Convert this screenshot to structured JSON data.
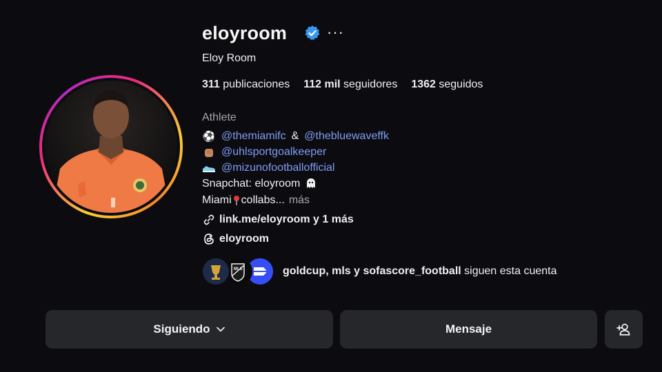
{
  "profile": {
    "username": "eloyroom",
    "more_label": "···",
    "full_name": "Eloy Room"
  },
  "stats": {
    "posts_value": "311",
    "posts_label": "publicaciones",
    "followers_value": "112 mil",
    "followers_label": "seguidores",
    "following_value": "1362",
    "following_label": "seguidos"
  },
  "bio": {
    "category": "Athlete",
    "line1": {
      "icon": "soccer-ball-icon",
      "mention1": "@themiamifc",
      "sep": "&",
      "mention2": "@thebluewaveffk"
    },
    "line2": {
      "icon": "fist-icon",
      "mention": "@uhlsportgoalkeeper"
    },
    "line3": {
      "icon": "sneaker-icon",
      "mention": "@mizunofootballofficial"
    },
    "line4": {
      "text": "Snapchat: eloyroom",
      "icon": "ghost-icon"
    },
    "line5": {
      "text_before": "Miami",
      "icon": "pin-icon",
      "text_after": "collabs...",
      "more": "más"
    },
    "link": {
      "icon": "link-icon",
      "text": "link.me/eloyroom y 1 más"
    },
    "threads": {
      "icon": "threads-icon",
      "text": "eloyroom"
    }
  },
  "followed_by": {
    "accounts": "goldcup, mls y sofascore_football",
    "suffix": "siguen esta cuenta"
  },
  "actions": {
    "following_label": "Siguiendo",
    "message_label": "Mensaje",
    "add_icon": "add-person-icon"
  },
  "colors": {
    "background": "#0c0c10",
    "button": "#26272b",
    "mention": "#7f9cf5",
    "verified": "#3897f0"
  }
}
